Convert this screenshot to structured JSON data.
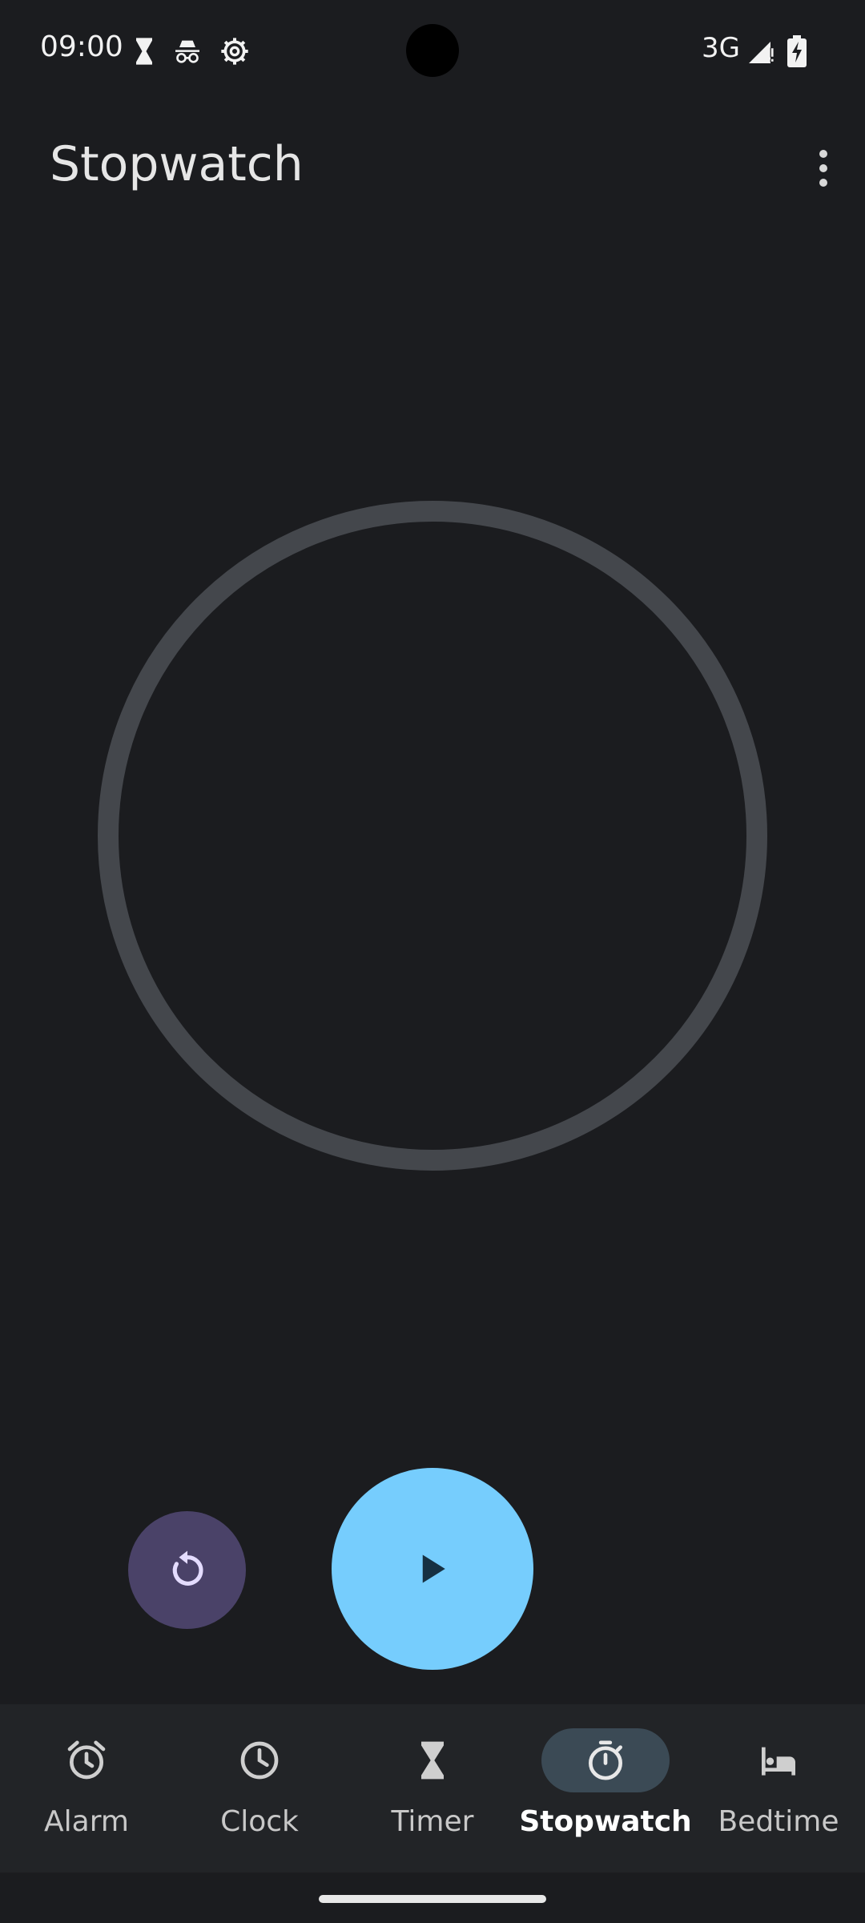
{
  "status_bar": {
    "time": "09:00",
    "network": "3G",
    "icons": [
      "hourglass-icon",
      "incognito-icon",
      "settings-gear-icon",
      "signal-icon",
      "battery-charging-icon"
    ]
  },
  "app_bar": {
    "title": "Stopwatch",
    "menu_icon": "more-vert-icon"
  },
  "stopwatch": {
    "state": "stopped",
    "reset_icon": "reset-icon",
    "start_icon": "play-icon"
  },
  "bottom_nav": {
    "items": [
      {
        "label": "Alarm",
        "icon": "alarm-icon"
      },
      {
        "label": "Clock",
        "icon": "clock-icon"
      },
      {
        "label": "Timer",
        "icon": "hourglass-icon"
      },
      {
        "label": "Stopwatch",
        "icon": "stopwatch-icon",
        "active": true
      },
      {
        "label": "Bedtime",
        "icon": "bed-icon"
      }
    ]
  },
  "colors": {
    "background": "#1b1c1f",
    "dial_ring": "#44474c",
    "start_button": "#76cdfd",
    "reset_button": "#4a4268",
    "nav_active_pill": "#3b4a55"
  }
}
